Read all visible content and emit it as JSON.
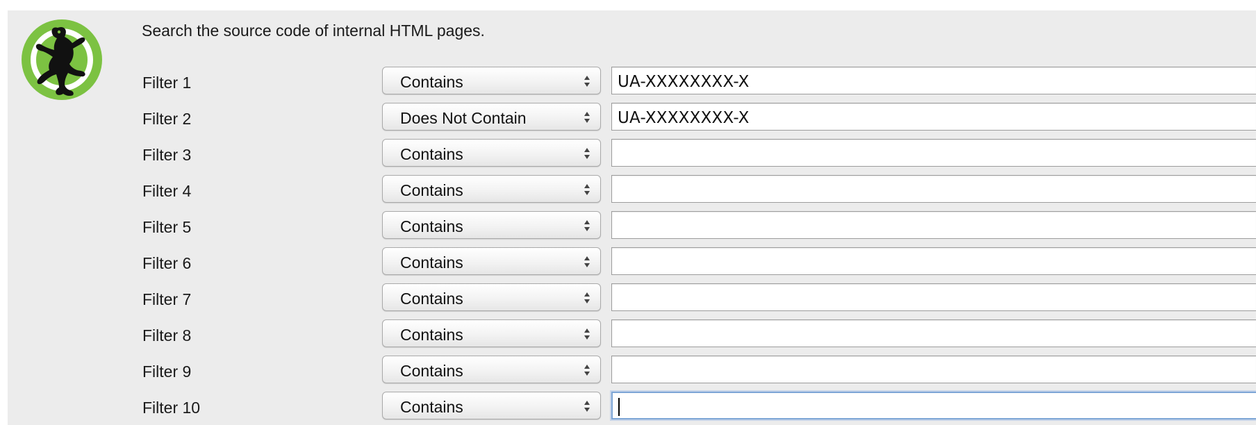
{
  "heading": "Search the source code of internal HTML pages.",
  "logo_icon": "frog-logo-icon",
  "filters": [
    {
      "label": "Filter 1",
      "mode": "Contains",
      "value": "UA-XXXXXXXX-X"
    },
    {
      "label": "Filter 2",
      "mode": "Does Not Contain",
      "value": "UA-XXXXXXXX-X"
    },
    {
      "label": "Filter 3",
      "mode": "Contains",
      "value": ""
    },
    {
      "label": "Filter 4",
      "mode": "Contains",
      "value": ""
    },
    {
      "label": "Filter 5",
      "mode": "Contains",
      "value": ""
    },
    {
      "label": "Filter 6",
      "mode": "Contains",
      "value": ""
    },
    {
      "label": "Filter 7",
      "mode": "Contains",
      "value": ""
    },
    {
      "label": "Filter 8",
      "mode": "Contains",
      "value": ""
    },
    {
      "label": "Filter 9",
      "mode": "Contains",
      "value": ""
    },
    {
      "label": "Filter 10",
      "mode": "Contains",
      "value": ""
    }
  ],
  "focused_filter": "Filter 10",
  "colors": {
    "panel_bg": "#ececec",
    "logo_green": "#7cc242",
    "focus_ring": "#7ea6d6"
  }
}
